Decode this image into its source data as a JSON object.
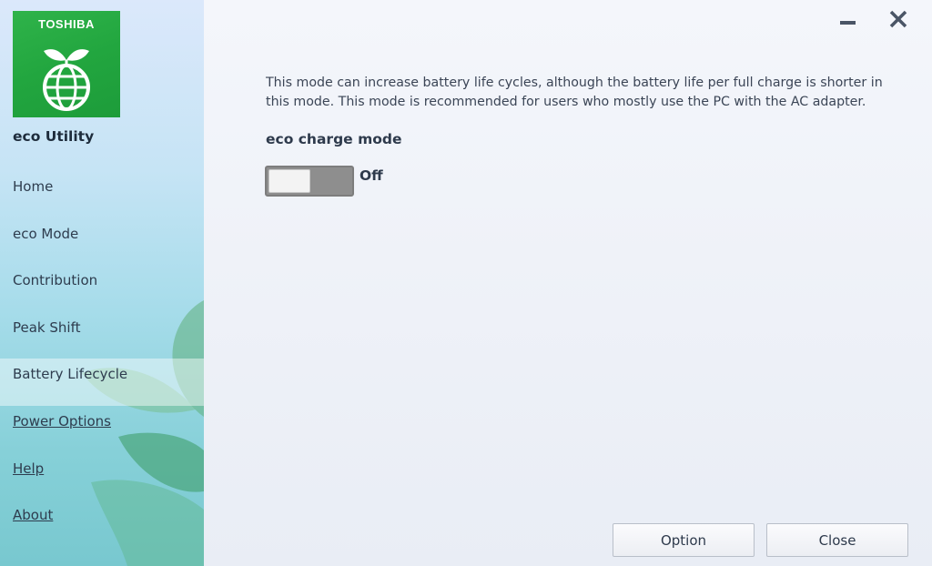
{
  "sidebar": {
    "logo_brand": "TOSHIBA",
    "app_title": "eco Utility",
    "items": [
      {
        "label": "Home"
      },
      {
        "label": "eco Mode"
      },
      {
        "label": "Contribution"
      },
      {
        "label": "Peak Shift"
      },
      {
        "label": "Battery Lifecycle",
        "active": true
      },
      {
        "label": "Power Options",
        "link": true
      },
      {
        "label": "Help",
        "link": true
      },
      {
        "label": "About",
        "link": true
      }
    ]
  },
  "window": {
    "minimize_icon": "minimize-icon",
    "close_icon": "close-icon"
  },
  "main": {
    "description": "This mode can increase battery life cycles, although the battery life per full charge is shorter in this mode. This mode is recommended for users who mostly use the PC with the AC adapter.",
    "section_label": "eco charge mode",
    "toggle_state": "Off"
  },
  "footer": {
    "option_label": "Option",
    "close_label": "Close"
  },
  "colors": {
    "logo_green": "#22a63f",
    "toggle_gray": "#8e8e8e"
  }
}
